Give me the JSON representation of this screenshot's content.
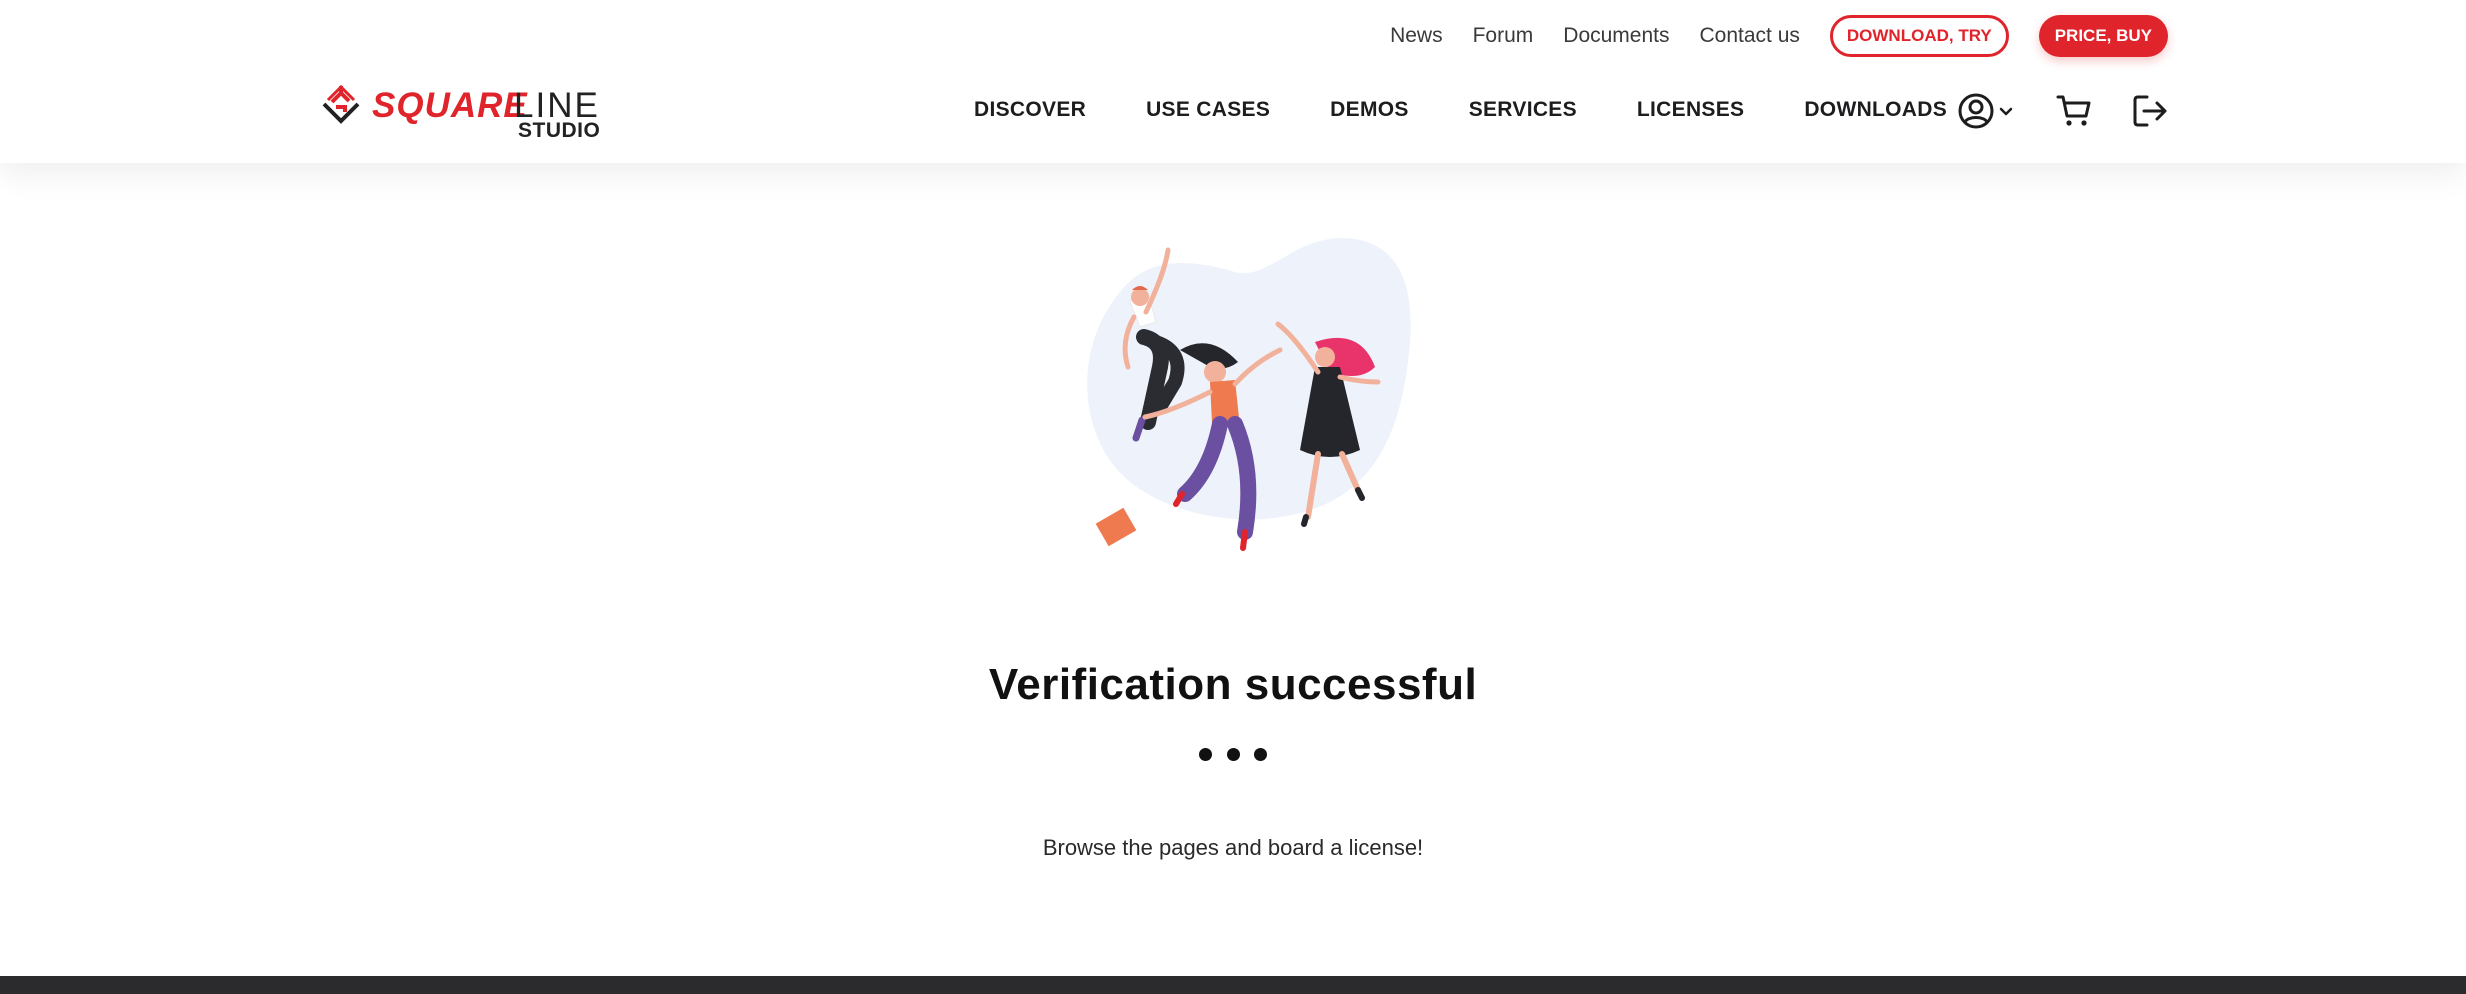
{
  "top_links": [
    "News",
    "Forum",
    "Documents",
    "Contact us"
  ],
  "buttons": {
    "download_try": "DOWNLOAD, TRY",
    "price_buy": "PRICE, BUY"
  },
  "logo": {
    "part1": "SQUARE",
    "part2": "LINE",
    "part3": "STUDIO"
  },
  "nav": [
    "DISCOVER",
    "USE CASES",
    "DEMOS",
    "SERVICES",
    "LICENSES",
    "DOWNLOADS"
  ],
  "icons": {
    "user": "user-circle-icon",
    "dropdown": "chevron-down-icon",
    "cart": "cart-icon",
    "logout": "logout-icon"
  },
  "content": {
    "title": "Verification successful",
    "subtitle": "Browse the pages and board a license!"
  },
  "colors": {
    "accent": "#e0242b",
    "text": "#1d1d1f",
    "footer": "#2b2b2d",
    "blob": "#eef3fb"
  }
}
